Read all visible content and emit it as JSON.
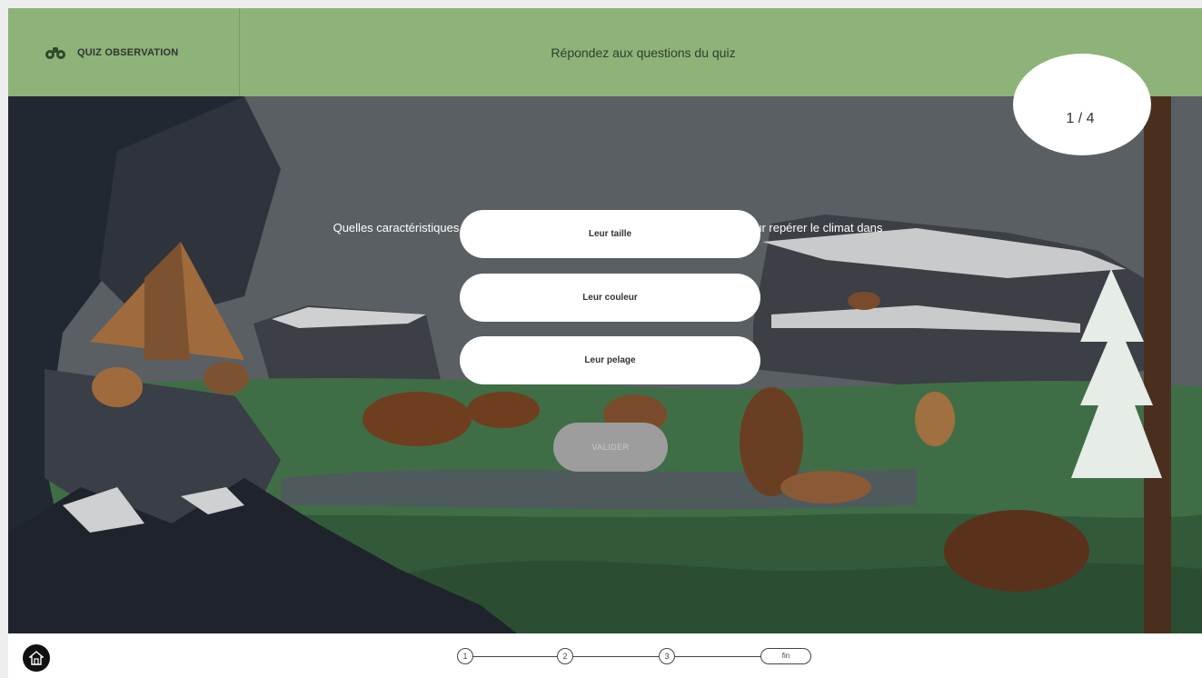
{
  "header": {
    "brand_label": "QUIZ OBSERVATION",
    "title": "Répondez aux questions du quiz"
  },
  "quiz": {
    "counter": "1 / 4",
    "question": "Quelles caractéristiques des animaux observés par Sofia pouvez-vous utiliser pour repérer le climat dans lequel ils vivent ?",
    "answers": [
      "Leur taille",
      "Leur couleur",
      "Leur pelage"
    ],
    "validate_label": "VALIDER"
  },
  "progress": {
    "steps": [
      "1",
      "2",
      "3"
    ],
    "end_label": "fin"
  },
  "colors": {
    "header_bg": "#8db379",
    "sky": "#5a5f63",
    "grass": "#3f6e46",
    "validate_disabled": "#9d9d9d"
  },
  "icons": {
    "brand": "binoculars-icon",
    "home": "home-icon"
  }
}
